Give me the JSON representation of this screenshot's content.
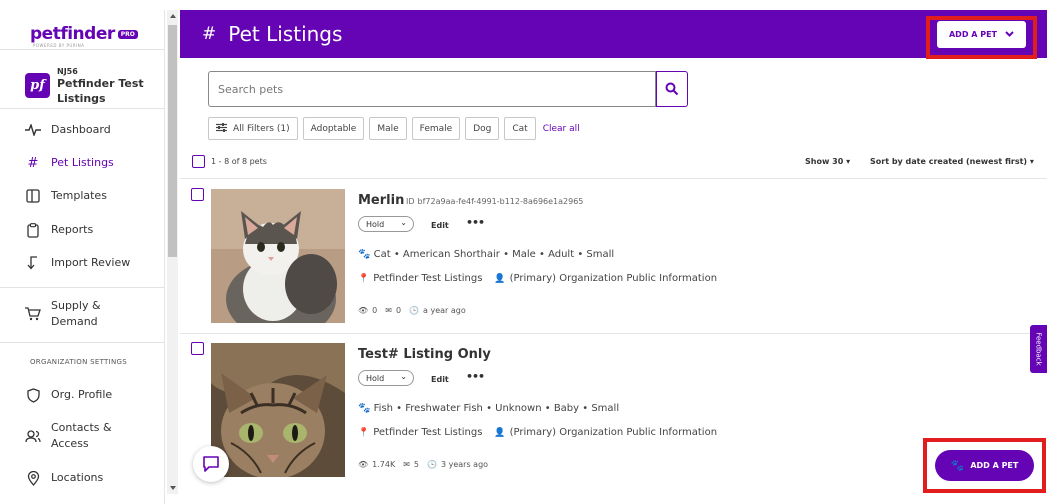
{
  "app": {
    "logo_text": "petfinder",
    "logo_badge": "PRO",
    "logo_sub": "POWERED BY PURINA"
  },
  "org": {
    "badge": "pf",
    "code": "NJ56",
    "name": "Petfinder Test Listings"
  },
  "sidebar": {
    "items": [
      {
        "label": "Dashboard",
        "icon": "activity-icon"
      },
      {
        "label": "Pet Listings",
        "icon": "hash-icon",
        "active": true
      },
      {
        "label": "Templates",
        "icon": "template-icon"
      },
      {
        "label": "Reports",
        "icon": "clipboard-icon"
      },
      {
        "label": "Import Review",
        "icon": "import-icon"
      },
      {
        "label": "Supply & Demand",
        "icon": "cart-icon"
      },
      {
        "label": "Org. Profile",
        "icon": "shield-icon"
      },
      {
        "label": "Contacts & Access",
        "icon": "users-icon"
      },
      {
        "label": "Locations",
        "icon": "location-pin-icon"
      }
    ],
    "section_label": "ORGANIZATION SETTINGS"
  },
  "header": {
    "hash": "#",
    "title": "Pet Listings",
    "add_button": "ADD A PET"
  },
  "search": {
    "placeholder": "Search pets"
  },
  "filters": {
    "all_filters": "All Filters (1)",
    "chips": [
      "Adoptable",
      "Male",
      "Female",
      "Dog",
      "Cat"
    ],
    "clear_all": "Clear all"
  },
  "results": {
    "count": "1 - 8 of 8 pets",
    "show": "Show 30",
    "sort": "Sort by date created (newest first)"
  },
  "pets": [
    {
      "name": "Merlin",
      "id_label": "ID",
      "id": "bf72a9aa-fe4f-4991-b112-8a696e1a2965",
      "status": "Hold",
      "edit": "Edit",
      "more": "•••",
      "description": "Cat • American Shorthair • Male • Adult • Small",
      "org": "Petfinder Test Listings",
      "contact": "(Primary) Organization Public Information",
      "views": "0",
      "messages": "0",
      "age": "a year ago"
    },
    {
      "name": "Test# Listing Only",
      "status": "Hold",
      "edit": "Edit",
      "more": "•••",
      "description": "Fish • Freshwater Fish • Unknown • Baby • Small",
      "org": "Petfinder Test Listings",
      "contact": "(Primary) Organization Public Information",
      "views": "1.74K",
      "messages": "5",
      "age": "3 years ago"
    }
  ],
  "feedback": "Feedback",
  "fab": {
    "label": "ADD A PET"
  },
  "colors": {
    "brand": "#6504b5",
    "highlight": "#e11d1d"
  }
}
